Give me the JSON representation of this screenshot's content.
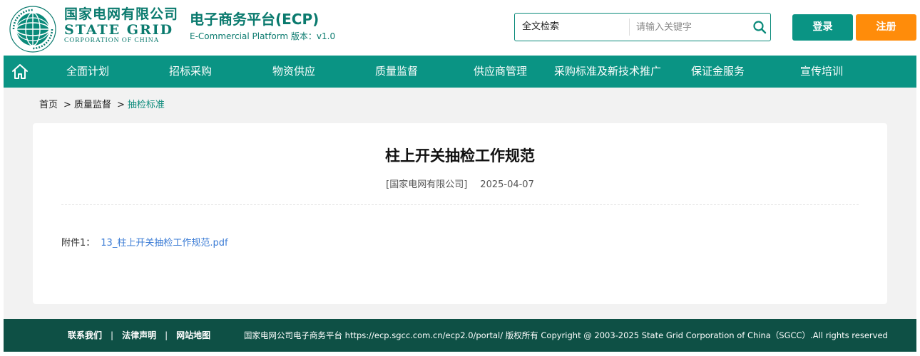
{
  "brand": {
    "company_cn": "国家电网有限公司",
    "company_en": "STATE GRID",
    "company_en_sub": "CORPORATION OF CHINA",
    "emblem_text_top": "国家电网公司",
    "emblem_text_ring": "STATE GRID CORPORATION OF CHINA"
  },
  "platform": {
    "title": "电子商务平台(ECP)",
    "subtitle": "E-Commercial Platform 版本：v1.0"
  },
  "search": {
    "scope": "全文检索",
    "placeholder": "请输入关键字",
    "value": "",
    "icon": "search-icon"
  },
  "auth": {
    "login_label": "登录",
    "register_label": "注册"
  },
  "nav": {
    "home_icon": "home-icon",
    "items": [
      {
        "label": "全面计划"
      },
      {
        "label": "招标采购"
      },
      {
        "label": "物资供应"
      },
      {
        "label": "质量监督"
      },
      {
        "label": "供应商管理"
      },
      {
        "label": "采购标准及新技术推广"
      },
      {
        "label": "保证金服务"
      },
      {
        "label": "宣传培训"
      }
    ]
  },
  "breadcrumb": {
    "home": "首页",
    "sep": ">",
    "level1": "质量监督",
    "current": "抽检标准"
  },
  "article": {
    "title": "柱上开关抽检工作规范",
    "source": "[国家电网有限公司]",
    "date": "2025-04-07",
    "attachment_label": "附件1：",
    "attachment_file": "13_柱上开关抽检工作规范.pdf"
  },
  "footer": {
    "contact": "联系我们",
    "legal": "法律声明",
    "sitemap": "网站地图",
    "sep": "|",
    "copyright": "国家电网公司电子商务平台 https://ecp.sgcc.com.cn/ecp2.0/portal/ 版权所有 Copyright @ 2003-2025 State Grid Corporation of China（SGCC）.All rights reserved"
  },
  "colors": {
    "brand_green": "#0a9484",
    "brand_green_dark": "#0a7a6e",
    "register_orange": "#ff8c0a",
    "footer_bg": "#0e5045",
    "link_blue": "#3a7bd5"
  }
}
